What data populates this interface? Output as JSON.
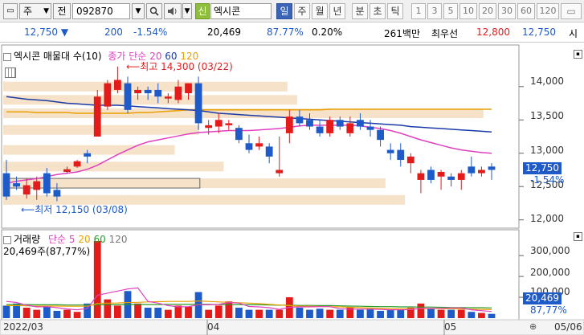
{
  "toolbar": {
    "type_label": "주",
    "field_label": "전",
    "code_value": "092870",
    "search_icon": "search-icon",
    "speaker_icon": "speaker-icon",
    "new_badge": "신",
    "stock_name": "엑시콘",
    "periods": [
      "일",
      "주",
      "월",
      "년",
      "분",
      "초",
      "틱"
    ],
    "active_period": "일",
    "numbers": [
      "1",
      "3",
      "5",
      "10",
      "20",
      "30",
      "60",
      "120"
    ]
  },
  "info": {
    "price": "12,750",
    "change": "200",
    "change_pct": "-1.54%",
    "volume": "20,469",
    "volume_ratio": "87.77%",
    "turnover": "0.20%",
    "amount": "261백만",
    "label": "최우선",
    "ask": "12,800",
    "bid": "12,750",
    "trailing": "시"
  },
  "price_panel": {
    "legend_name": "엑시콘 매물대 수(10)",
    "ma_label": "종가 단순",
    "ma_periods": [
      "20",
      "60",
      "120"
    ],
    "max_label": "최고 14,300 (03/22)",
    "min_label": "최저 12,150 (03/08)",
    "y_labels": [
      "14,000",
      "13,500",
      "13,000",
      "12,500",
      "12,000"
    ],
    "last_price": "12,750",
    "last_pct": "-1.54%"
  },
  "volume_panel": {
    "legend_name": "거래량",
    "ma_label": "단순",
    "ma_periods": [
      "5",
      "20",
      "60",
      "120"
    ],
    "current": "20,469주(87,77%)",
    "y_labels": [
      "300,000",
      "200,000",
      "100,000"
    ],
    "last_volume": "20,469",
    "last_pct": "87,77%"
  },
  "x_labels": [
    "2022/03",
    "04",
    "05",
    "05/06"
  ],
  "colors": {
    "up": "#e41b1b",
    "down": "#1e5ac8",
    "ma20": "#e040c0",
    "ma60": "#1a3aa8",
    "ma120": "#e8a000",
    "profile": "#f4dcc0"
  },
  "chart_data": {
    "type": "candlestick",
    "ylim": [
      11900,
      14600
    ],
    "candles": [
      {
        "o": 12700,
        "h": 12900,
        "l": 12300,
        "c": 12350
      },
      {
        "o": 12550,
        "h": 12650,
        "l": 12450,
        "c": 12500
      },
      {
        "o": 12380,
        "h": 12620,
        "l": 12320,
        "c": 12520
      },
      {
        "o": 12450,
        "h": 12650,
        "l": 12300,
        "c": 12580
      },
      {
        "o": 12700,
        "h": 12780,
        "l": 12350,
        "c": 12400
      },
      {
        "o": 12450,
        "h": 12550,
        "l": 12280,
        "c": 12350
      },
      {
        "o": 12720,
        "h": 12800,
        "l": 12700,
        "c": 12760
      },
      {
        "o": 12800,
        "h": 12900,
        "l": 12780,
        "c": 12880
      },
      {
        "o": 13000,
        "h": 13050,
        "l": 12850,
        "c": 12950
      },
      {
        "o": 13250,
        "h": 13950,
        "l": 13250,
        "c": 13850
      },
      {
        "o": 13700,
        "h": 14100,
        "l": 13650,
        "c": 14050
      },
      {
        "o": 13950,
        "h": 14300,
        "l": 13900,
        "c": 14100
      },
      {
        "o": 14050,
        "h": 14150,
        "l": 13600,
        "c": 13650
      },
      {
        "o": 13900,
        "h": 14000,
        "l": 13800,
        "c": 13950
      },
      {
        "o": 13950,
        "h": 14000,
        "l": 13800,
        "c": 13900
      },
      {
        "o": 13950,
        "h": 14050,
        "l": 13750,
        "c": 13850
      },
      {
        "o": 13820,
        "h": 13900,
        "l": 13750,
        "c": 13850
      },
      {
        "o": 13800,
        "h": 14100,
        "l": 13750,
        "c": 14000
      },
      {
        "o": 13900,
        "h": 14050,
        "l": 13800,
        "c": 14050
      },
      {
        "o": 14050,
        "h": 14150,
        "l": 13350,
        "c": 13450
      },
      {
        "o": 13380,
        "h": 13500,
        "l": 13280,
        "c": 13420
      },
      {
        "o": 13400,
        "h": 13600,
        "l": 13300,
        "c": 13500
      },
      {
        "o": 13420,
        "h": 13500,
        "l": 13350,
        "c": 13450
      },
      {
        "o": 13380,
        "h": 13420,
        "l": 13150,
        "c": 13200
      },
      {
        "o": 13150,
        "h": 13280,
        "l": 13000,
        "c": 13050
      },
      {
        "o": 13100,
        "h": 13250,
        "l": 13050,
        "c": 13150
      },
      {
        "o": 13100,
        "h": 13150,
        "l": 12850,
        "c": 12950
      },
      {
        "o": 12700,
        "h": 13250,
        "l": 12650,
        "c": 12750
      },
      {
        "o": 13300,
        "h": 13650,
        "l": 13150,
        "c": 13550
      },
      {
        "o": 13550,
        "h": 13650,
        "l": 13400,
        "c": 13450
      },
      {
        "o": 13500,
        "h": 13600,
        "l": 13350,
        "c": 13400
      },
      {
        "o": 13400,
        "h": 13500,
        "l": 13250,
        "c": 13300
      },
      {
        "o": 13300,
        "h": 13550,
        "l": 13250,
        "c": 13500
      },
      {
        "o": 13500,
        "h": 13550,
        "l": 13350,
        "c": 13400
      },
      {
        "o": 13300,
        "h": 13550,
        "l": 13250,
        "c": 13450
      },
      {
        "o": 13500,
        "h": 13600,
        "l": 13350,
        "c": 13400
      },
      {
        "o": 13400,
        "h": 13500,
        "l": 13250,
        "c": 13350
      },
      {
        "o": 13350,
        "h": 13400,
        "l": 13100,
        "c": 13200
      },
      {
        "o": 13050,
        "h": 13150,
        "l": 12900,
        "c": 13000
      },
      {
        "o": 13050,
        "h": 13150,
        "l": 12800,
        "c": 12900
      },
      {
        "o": 12850,
        "h": 13000,
        "l": 12700,
        "c": 12950
      },
      {
        "o": 12600,
        "h": 12750,
        "l": 12400,
        "c": 12700
      },
      {
        "o": 12750,
        "h": 12800,
        "l": 12550,
        "c": 12600
      },
      {
        "o": 12650,
        "h": 12750,
        "l": 12450,
        "c": 12720
      },
      {
        "o": 12650,
        "h": 12700,
        "l": 12500,
        "c": 12600
      },
      {
        "o": 12600,
        "h": 12750,
        "l": 12450,
        "c": 12700
      },
      {
        "o": 12800,
        "h": 12950,
        "l": 12650,
        "c": 12700
      },
      {
        "o": 12700,
        "h": 12800,
        "l": 12650,
        "c": 12750
      },
      {
        "o": 12800,
        "h": 12850,
        "l": 12600,
        "c": 12750
      }
    ],
    "ma20": [
      12550,
      12580,
      12600,
      12620,
      12650,
      12680,
      12700,
      12720,
      12760,
      12820,
      12900,
      12980,
      13050,
      13120,
      13170,
      13200,
      13230,
      13260,
      13290,
      13310,
      13320,
      13330,
      13340,
      13340,
      13340,
      13350,
      13360,
      13370,
      13390,
      13410,
      13420,
      13420,
      13420,
      13420,
      13420,
      13410,
      13390,
      13370,
      13340,
      13300,
      13250,
      13200,
      13160,
      13120,
      13080,
      13050,
      13030,
      13010,
      13000
    ],
    "ma60": [
      13850,
      13830,
      13810,
      13800,
      13790,
      13770,
      13750,
      13740,
      13730,
      13720,
      13720,
      13720,
      13710,
      13700,
      13690,
      13680,
      13670,
      13660,
      13650,
      13640,
      13620,
      13600,
      13590,
      13580,
      13570,
      13560,
      13550,
      13540,
      13530,
      13520,
      13510,
      13500,
      13490,
      13480,
      13470,
      13460,
      13450,
      13440,
      13430,
      13420,
      13400,
      13390,
      13380,
      13370,
      13360,
      13350,
      13340,
      13330,
      13320
    ],
    "ma120": [
      13620,
      13620,
      13620,
      13610,
      13610,
      13610,
      13610,
      13600,
      13600,
      13600,
      13600,
      13600,
      13600,
      13610,
      13610,
      13620,
      13630,
      13640,
      13650,
      13650,
      13650,
      13650,
      13650,
      13650,
      13650,
      13650,
      13650,
      13650,
      13650,
      13650,
      13650,
      13650,
      13660,
      13660,
      13660,
      13660,
      13660,
      13660,
      13660,
      13660,
      13660,
      13660,
      13660,
      13660,
      13660,
      13660,
      13660,
      13660,
      13660
    ],
    "volume_ylim": [
      0,
      370000
    ],
    "volumes": [
      60000,
      70000,
      50000,
      40000,
      55000,
      35000,
      40000,
      30000,
      70000,
      370000,
      90000,
      60000,
      130000,
      70000,
      50000,
      50000,
      40000,
      60000,
      55000,
      125000,
      40000,
      60000,
      80000,
      50000,
      40000,
      40000,
      40000,
      40000,
      100000,
      50000,
      40000,
      45000,
      40000,
      40000,
      50000,
      40000,
      45000,
      35000,
      40000,
      40000,
      50000,
      70000,
      45000,
      40000,
      40000,
      40000,
      30000,
      25000,
      20469
    ],
    "vol_ma5": [
      80000,
      75000,
      62000,
      54000,
      55000,
      50000,
      44000,
      40000,
      46000,
      110000,
      120000,
      130000,
      140000,
      145000,
      80000,
      72000,
      60000,
      54000,
      55000,
      64000,
      64000,
      66000,
      75000,
      72000,
      56000,
      54000,
      50000,
      42000,
      52000,
      54000,
      54000,
      55000,
      55000,
      45000,
      43000,
      43000,
      43000,
      42000,
      40000,
      40000,
      41000,
      47000,
      47000,
      47000,
      49000,
      49000,
      40000,
      36000,
      32000
    ],
    "vol_ma20": [
      60000,
      60000,
      59000,
      58000,
      58000,
      58000,
      57000,
      57000,
      57000,
      70000,
      72000,
      73000,
      75000,
      76000,
      78000,
      79000,
      80000,
      80000,
      80000,
      82000,
      80000,
      78000,
      76000,
      74000,
      72000,
      70000,
      66000,
      63000,
      60000,
      58000,
      57000,
      56000,
      55000,
      54000,
      52000,
      50000,
      48000,
      47000,
      46000,
      45000,
      45000,
      46000,
      46000,
      45000,
      45000,
      44000,
      43000,
      42000,
      41000
    ],
    "vol_ma60": [
      65000,
      65000,
      65000,
      64000,
      64000,
      64000,
      63000,
      63000,
      63000,
      64000,
      64000,
      64000,
      65000,
      65000,
      65000,
      65000,
      66000,
      66000,
      66000,
      66000,
      66000,
      65000,
      65000,
      65000,
      64000,
      64000,
      63000,
      62000,
      62000,
      61000,
      61000,
      60000,
      60000,
      59000,
      58000,
      57000,
      56000,
      55000,
      55000,
      54000,
      54000,
      53000,
      53000,
      52000,
      51000,
      51000,
      50000,
      50000,
      49000
    ],
    "profile": [
      {
        "price": 12300,
        "width": 0.82
      },
      {
        "price": 12550,
        "width": 0.78
      },
      {
        "price": 12800,
        "width": 0.45
      },
      {
        "price": 13050,
        "width": 0.35
      },
      {
        "price": 13350,
        "width": 0.4
      },
      {
        "price": 13600,
        "width": 0.98
      },
      {
        "price": 13800,
        "width": 0.6
      },
      {
        "price": 14000,
        "width": 0.58
      }
    ]
  }
}
